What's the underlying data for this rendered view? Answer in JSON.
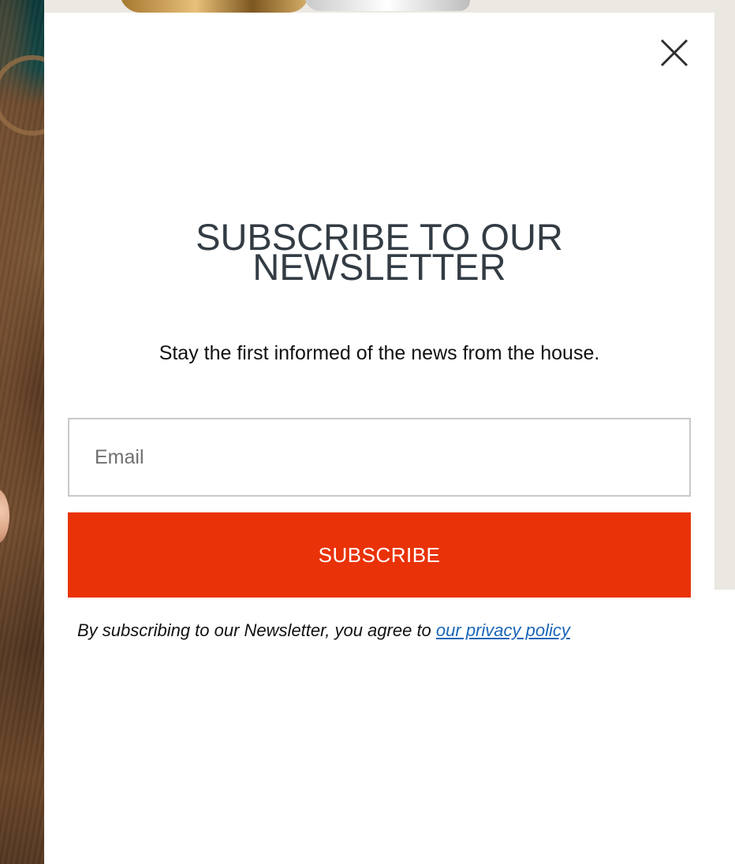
{
  "modal": {
    "title_line1": "SUBSCRIBE TO OUR",
    "title_line2": "NEWSLETTER",
    "subtitle": "Stay the first informed of the news from the house.",
    "email_placeholder": "Email",
    "email_value": "",
    "subscribe_label": "SUBSCRIBE",
    "legal_text": "By subscribing to our Newsletter, you agree to ",
    "privacy_link_label": "our privacy policy",
    "close_icon": "close-icon"
  },
  "colors": {
    "accent_button": "#e93208",
    "title_text": "#333c44",
    "link": "#1a66b8",
    "input_border": "#c9c9c9"
  }
}
